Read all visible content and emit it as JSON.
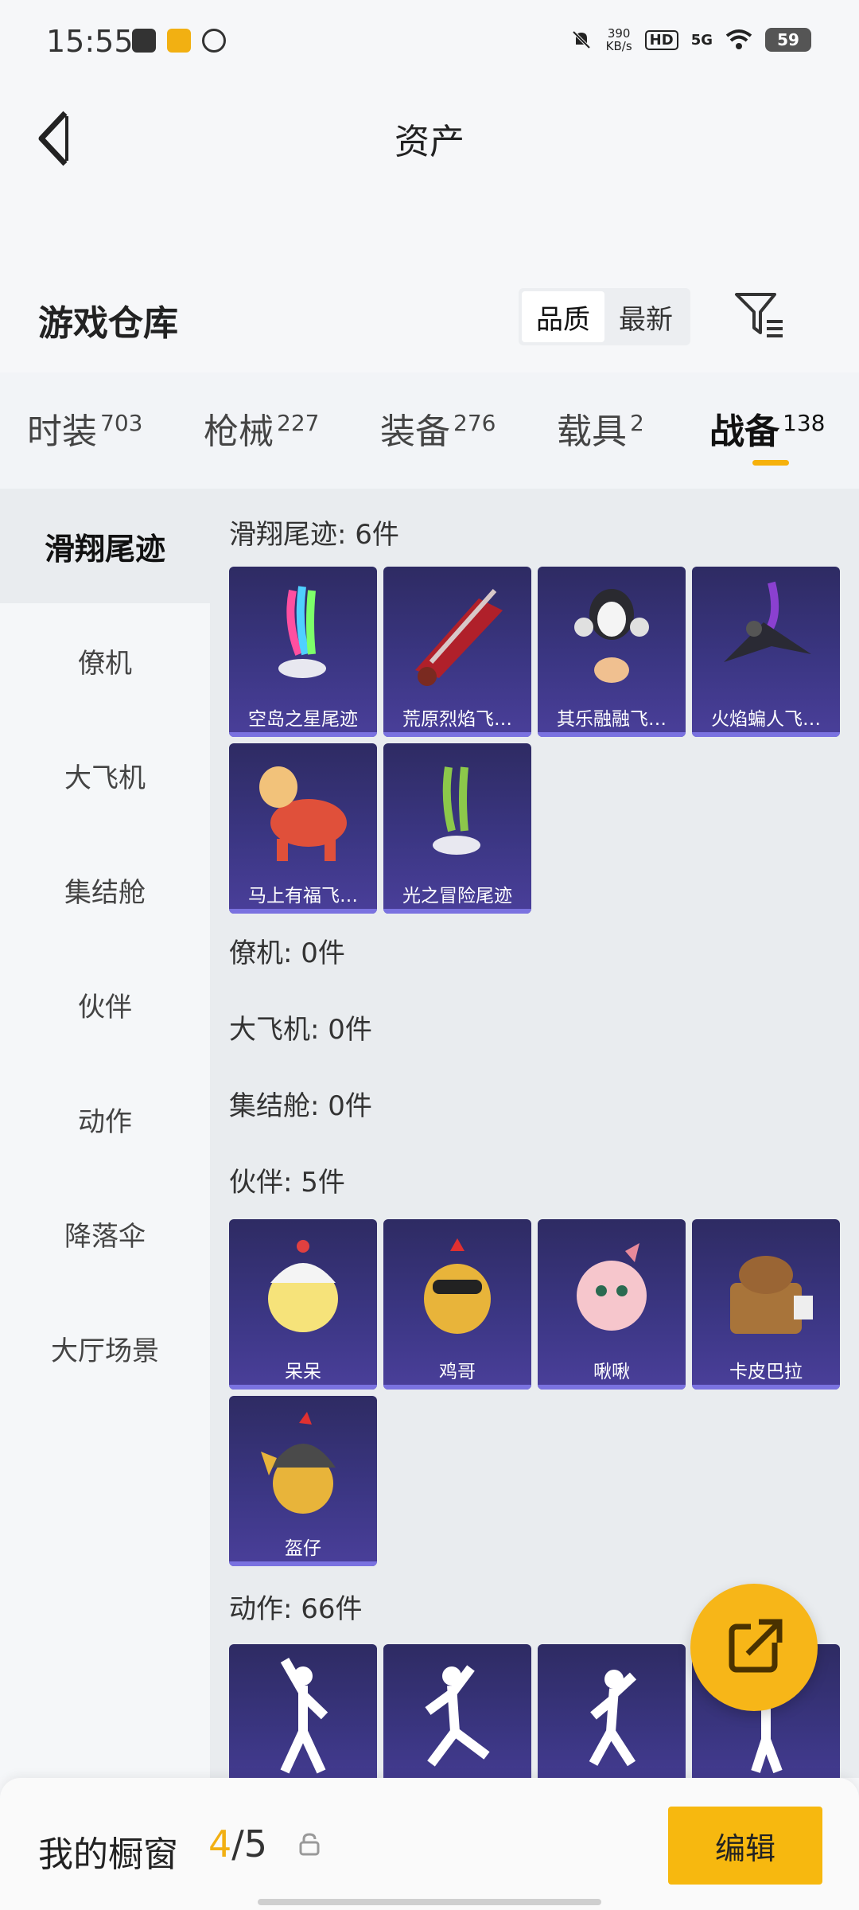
{
  "status_bar": {
    "time": "15:55",
    "speed_value": "390",
    "speed_unit": "KB/s",
    "hd": "HD",
    "network": "5G",
    "battery": "59"
  },
  "header": {
    "title": "资产",
    "back_icon": "chevron-left-icon"
  },
  "warehouse": {
    "title": "游戏仓库",
    "sort_options": [
      "品质",
      "最新"
    ],
    "sort_selected": "品质",
    "filter_icon": "filter-icon"
  },
  "tabs": [
    {
      "label": "时装",
      "count": "703"
    },
    {
      "label": "枪械",
      "count": "227"
    },
    {
      "label": "装备",
      "count": "276"
    },
    {
      "label": "载具",
      "count": "2"
    },
    {
      "label": "战备",
      "count": "138",
      "active": true
    }
  ],
  "sidebar": [
    {
      "label": "滑翔尾迹",
      "active": true
    },
    {
      "label": "僚机"
    },
    {
      "label": "大飞机"
    },
    {
      "label": "集结舱"
    },
    {
      "label": "伙伴"
    },
    {
      "label": "动作"
    },
    {
      "label": "降落伞"
    },
    {
      "label": "大厅场景"
    }
  ],
  "sections": [
    {
      "title": "滑翔尾迹: 6件",
      "items": [
        "空岛之星尾迹",
        "荒原烈焰飞…",
        "其乐融融飞…",
        "火焰蝙人飞…",
        "马上有福飞…",
        "光之冒险尾迹"
      ]
    },
    {
      "title": "僚机: 0件",
      "items": []
    },
    {
      "title": "大飞机: 0件",
      "items": []
    },
    {
      "title": "集结舱: 0件",
      "items": []
    },
    {
      "title": "伙伴: 5件",
      "items": [
        "呆呆",
        "鸡哥",
        "啾啾",
        "卡皮巴拉",
        "盔仔"
      ]
    },
    {
      "title": "动作: 66件",
      "items": []
    }
  ],
  "bottom_bar": {
    "label": "我的橱窗",
    "current": "4",
    "separator": "/",
    "total": "5",
    "edit_label": "编辑"
  },
  "colors": {
    "accent": "#f7b80f",
    "card": "#3b3683"
  }
}
